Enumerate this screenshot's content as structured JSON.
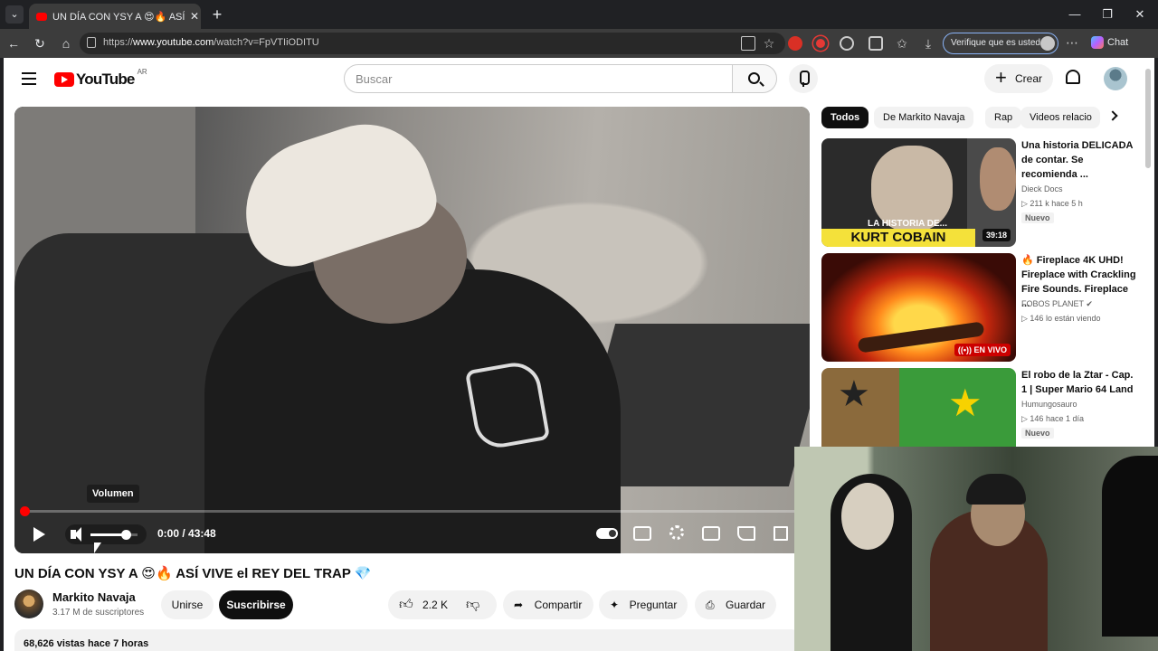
{
  "browser": {
    "tab_title": "UN DÍA CON YSY A 😍🔥 ASÍ VIVE",
    "url_prefix": "https://",
    "url_domain": "www.youtube.com",
    "url_path": "/watch?v=FpVTIiODITU",
    "verify_label": "Verifique que es usted",
    "chat_label": "Chat"
  },
  "header": {
    "logo_text": "YouTube",
    "country_code": "AR",
    "search_placeholder": "Buscar",
    "create_label": "Crear"
  },
  "player": {
    "tooltip": "Volumen",
    "time": "0:00 / 43:48",
    "progress_fraction": 0.0,
    "volume_fraction": 0.75
  },
  "video": {
    "title": "UN DÍA CON YSY A 😍🔥 ASÍ VIVE el REY DEL TRAP 💎",
    "channel_name": "Markito Navaja",
    "subscribers": "3.17 M de suscriptores",
    "join_label": "Unirse",
    "subscribe_label": "Suscribirse",
    "likes": "2.2 K",
    "share_label": "Compartir",
    "ask_label": "Preguntar",
    "save_label": "Guardar",
    "meta": "68,626 vistas  hace 7 horas"
  },
  "chips": [
    "Todos",
    "De Markito Navaja",
    "Rap",
    "Videos relacio"
  ],
  "recommendations": [
    {
      "title": "Una historia DELICADA de contar. Se recomienda ...",
      "channel": "Dieck Docs",
      "stats": "▷ 211 k   hace 5 h",
      "badge": "Nuevo",
      "duration": "39:18",
      "thumb_caption": "LA HISTORIA DE...",
      "thumb_banner": "KURT COBAIN"
    },
    {
      "title": "🔥 Fireplace 4K UHD! Fireplace with Crackling Fire Sounds. Fireplace ...",
      "channel": "FOBOS PLANET ✔",
      "stats": "▷ 146 lo están viendo",
      "live_badge": "((•)) EN VIVO"
    },
    {
      "title": "El robo de la Ztar - Cap. 1 | Super Mario 64 Land",
      "channel": "Humungosauro",
      "stats": "▷ 146   hace 1 día",
      "badge": "Nuevo"
    }
  ],
  "icons": [
    "tab-list-icon",
    "youtube-favicon",
    "close-tab-icon",
    "new-tab-icon",
    "back-icon",
    "reload-icon",
    "home-icon",
    "lock-icon",
    "menu-icon",
    "search-icon",
    "microphone-icon",
    "bell-icon",
    "play-icon",
    "volume-icon",
    "settings-icon",
    "fullscreen-icon"
  ],
  "colors": {
    "youtube_red": "#ff0000",
    "live_red": "#cc0000",
    "banner_yellow": "#f4e13a"
  }
}
